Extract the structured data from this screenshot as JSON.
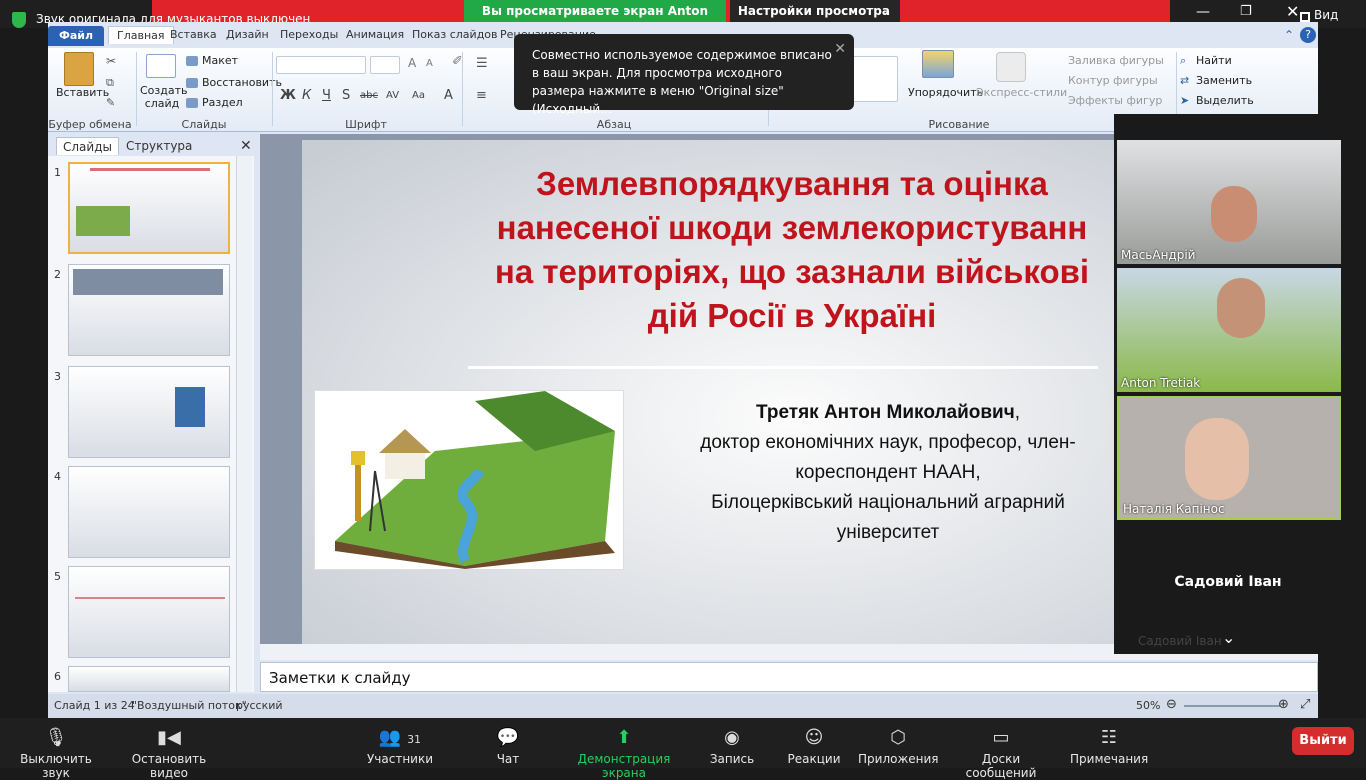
{
  "zoom_top": {
    "sound_notice": "Звук оригинала для музыкантов выключен",
    "share_status": "Вы просматриваете экран Anton Tretiak",
    "view_settings": "Настройки просмотра",
    "view_btn": "Вид"
  },
  "ppt": {
    "tabs": [
      "Файл",
      "Главная",
      "Вставка",
      "Дизайн",
      "Переходы",
      "Анимация",
      "Показ слайдов",
      "Рецензирование"
    ],
    "ribbon": {
      "paste": "Вставить",
      "new_slide": "Создать слайд",
      "layout": "Макет",
      "reset": "Восстановить",
      "section": "Раздел",
      "clipboard_group": "Буфер обмена",
      "slides_group": "Слайды",
      "font_group": "Шрифт",
      "paragraph_group": "Абзац",
      "drawing_group": "Рисование",
      "arrange": "Упорядочить",
      "quick_styles": "Экспресс-стили",
      "shape_fill": "Заливка фигуры",
      "shape_outline": "Контур фигуры",
      "shape_effects": "Эффекты фигур",
      "find": "Найти",
      "replace": "Заменить",
      "select": "Выделить"
    },
    "tooltip": "Совместно используемое содержимое вписано в ваш экран. Для просмотра исходного размера нажмите в меню \"Original size\" (Исходный...",
    "pane_tabs": {
      "slides": "Слайды",
      "outline": "Структура"
    },
    "thumb_numbers": [
      "1",
      "2",
      "3",
      "4",
      "5",
      "6"
    ],
    "slide": {
      "title": "Землевпорядкування та оцінка\nнанесеної шкоди землекористуванн\nна територіях, що зазнали військові\nдій Росії в Україні",
      "author_name": "Третяк Антон Миколайович",
      "author_line2": "доктор економічних наук, професор, член-кореспондент НААН,",
      "author_line3": "Білоцерківський національний аграрний університет"
    },
    "notes_placeholder": "Заметки к слайду",
    "status": {
      "slide_counter": "Слайд 1 из 24",
      "theme": "\"Воздушный поток\"",
      "language": "русский",
      "zoom": "50%"
    }
  },
  "participants": [
    {
      "name": "МасьАндрій"
    },
    {
      "name": "Anton Tretiak"
    },
    {
      "name": "Наталія Капінос"
    },
    {
      "name": "Садовий Іван"
    }
  ],
  "participant_faded": "Садовий Іван",
  "zoom_bottom": {
    "mute": "Выключить звук",
    "video": "Остановить видео",
    "participants": "Участники",
    "participants_count": "31",
    "chat": "Чат",
    "share": "Демонстрация экрана",
    "record": "Запись",
    "reactions": "Реакции",
    "apps": "Приложения",
    "whiteboards": "Доски сообщений",
    "notes": "Примечания",
    "leave": "Выйти"
  }
}
